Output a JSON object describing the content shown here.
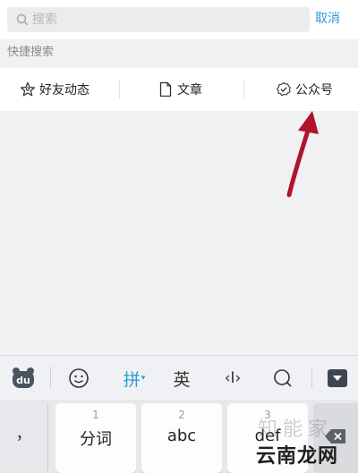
{
  "search": {
    "placeholder": "搜索",
    "cancel_label": "取消"
  },
  "quick_search": {
    "label": "快捷搜索",
    "items": [
      {
        "label": "好友动态",
        "icon": "star-person-icon"
      },
      {
        "label": "文章",
        "icon": "document-icon"
      },
      {
        "label": "公众号",
        "icon": "verified-badge-icon"
      }
    ]
  },
  "keyboard": {
    "toolbar": {
      "logo_text": "du",
      "pinyin_label": "拼",
      "english_label": "英",
      "cursor_label": "‹I›"
    },
    "keys": {
      "left_symbol": "，",
      "key1": {
        "number": "1",
        "label": "分词"
      },
      "key2": {
        "number": "2",
        "label": "abc"
      },
      "key3": {
        "number": "3",
        "label": "def"
      }
    }
  },
  "watermark": {
    "top_text": "知能家",
    "bottom_text": "云南龙网"
  },
  "colors": {
    "accent": "#2f9ad6",
    "arrow": "#b0142a",
    "background": "#f1f1f3"
  }
}
